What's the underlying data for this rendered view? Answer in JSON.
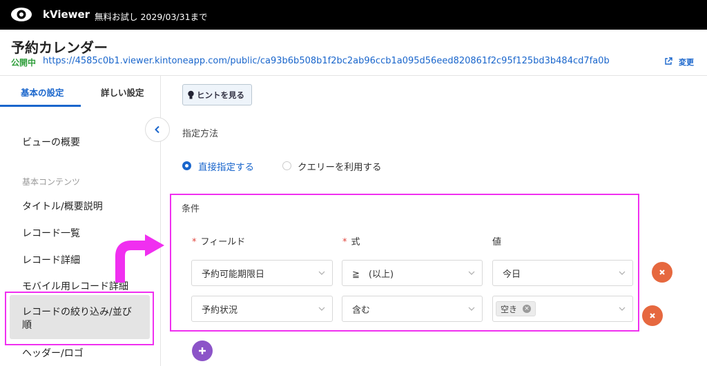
{
  "app": {
    "brand": "kViewer",
    "trial_notice": "無料お試し 2029/03/31まで"
  },
  "header": {
    "title": "予約カレンダー",
    "status_badge": "公開中",
    "public_url": "https://4585c0b1.viewer.kintoneapp.com/public/ca93b6b508b1f2bc2ab96ccb1a095d56eed820861f2c95f125bd3b484cd7fa0b",
    "change_label": "変更"
  },
  "sidebar": {
    "tabs": [
      {
        "label": "基本の設定",
        "active": true
      },
      {
        "label": "詳しい設定",
        "active": false
      }
    ],
    "overview": "ビューの概要",
    "group_label": "基本コンテンツ",
    "items": [
      "タイトル/概要説明",
      "レコード一覧",
      "レコード詳細",
      "モバイル用レコード詳細",
      "レコードの絞り込み/並び順",
      "ヘッダー/ロゴ"
    ],
    "active_index": 4
  },
  "main": {
    "hint_button": "ヒントを見る",
    "method_label": "指定方法",
    "method_options": [
      {
        "label": "直接指定する",
        "selected": true
      },
      {
        "label": "クエリーを利用する",
        "selected": false
      }
    ],
    "conditions": {
      "title": "条件",
      "columns": [
        {
          "label": "フィールド",
          "required": true
        },
        {
          "label": "式",
          "required": true
        },
        {
          "label": "値",
          "required": false
        }
      ],
      "rows": [
        {
          "field": "予約可能期限日",
          "operator": "≧　(以上)",
          "value": "今日"
        },
        {
          "field": "予約状況",
          "operator": "含む",
          "value_tag": "空き"
        }
      ]
    }
  },
  "colors": {
    "accent": "#1a66cc",
    "highlight": "#f02ff0",
    "delete": "#e6683f",
    "add": "#8c54c8",
    "published": "#2e9e3a"
  },
  "icons": [
    "eye-icon",
    "external-link-icon",
    "chevron-left-icon",
    "lightbulb-icon",
    "chevron-down-icon",
    "close-icon",
    "plus-icon"
  ]
}
